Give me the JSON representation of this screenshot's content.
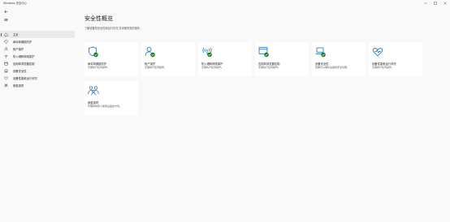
{
  "window": {
    "title": "Windows 安全中心",
    "controls": [
      "minimize",
      "maximize",
      "close"
    ]
  },
  "sidebar": {
    "back_icon": "back-arrow-icon",
    "menu_icon": "hamburger-menu-icon",
    "items": [
      {
        "label": "主页",
        "icon": "home-icon",
        "active": true
      },
      {
        "label": "病毒和威胁防护",
        "icon": "shield-icon",
        "active": false
      },
      {
        "label": "帐户保护",
        "icon": "person-icon",
        "active": false
      },
      {
        "label": "防火墙和网络保护",
        "icon": "wifi-icon",
        "active": false
      },
      {
        "label": "应用和浏览器控制",
        "icon": "browser-window-icon",
        "active": false
      },
      {
        "label": "设备安全性",
        "icon": "laptop-icon",
        "active": false
      },
      {
        "label": "设备性能和运行状况",
        "icon": "heart-icon",
        "active": false
      },
      {
        "label": "家庭选项",
        "icon": "family-icon",
        "active": false
      }
    ]
  },
  "main": {
    "title": "安全性概览",
    "subtitle": "了解设备的安全性和运行状况,并采取所需的操作。",
    "tiles": [
      {
        "title": "病毒和威胁防护",
        "status": "无需执行任何操作。",
        "icon": "shield-check-icon"
      },
      {
        "title": "帐户保护",
        "status": "无需执行任何操作。",
        "icon": "person-check-icon"
      },
      {
        "title": "防火墙和网络保护",
        "status": "无需执行任何操作。",
        "icon": "wifi-check-icon"
      },
      {
        "title": "应用和浏览器控制",
        "status": "无需执行任何操作。",
        "icon": "browser-check-icon"
      },
      {
        "title": "设备安全性",
        "status": "查看可以保护设备的安全功能。",
        "icon": "laptop-check-icon"
      },
      {
        "title": "设备性能和运行状况",
        "status": "无需执行任何操作。",
        "icon": "heart-icon"
      },
      {
        "title": "家庭选项",
        "status": "管理你的家人使用设备的方式。",
        "icon": "family-icon"
      }
    ]
  },
  "colors": {
    "accent": "#0067c0",
    "ok": "#107c10",
    "icon_stroke": "#0f6cbd",
    "tile_bg": "#ffffff",
    "page_bg": "#f9f9f9",
    "active_nav_bg": "#eaeaea"
  }
}
